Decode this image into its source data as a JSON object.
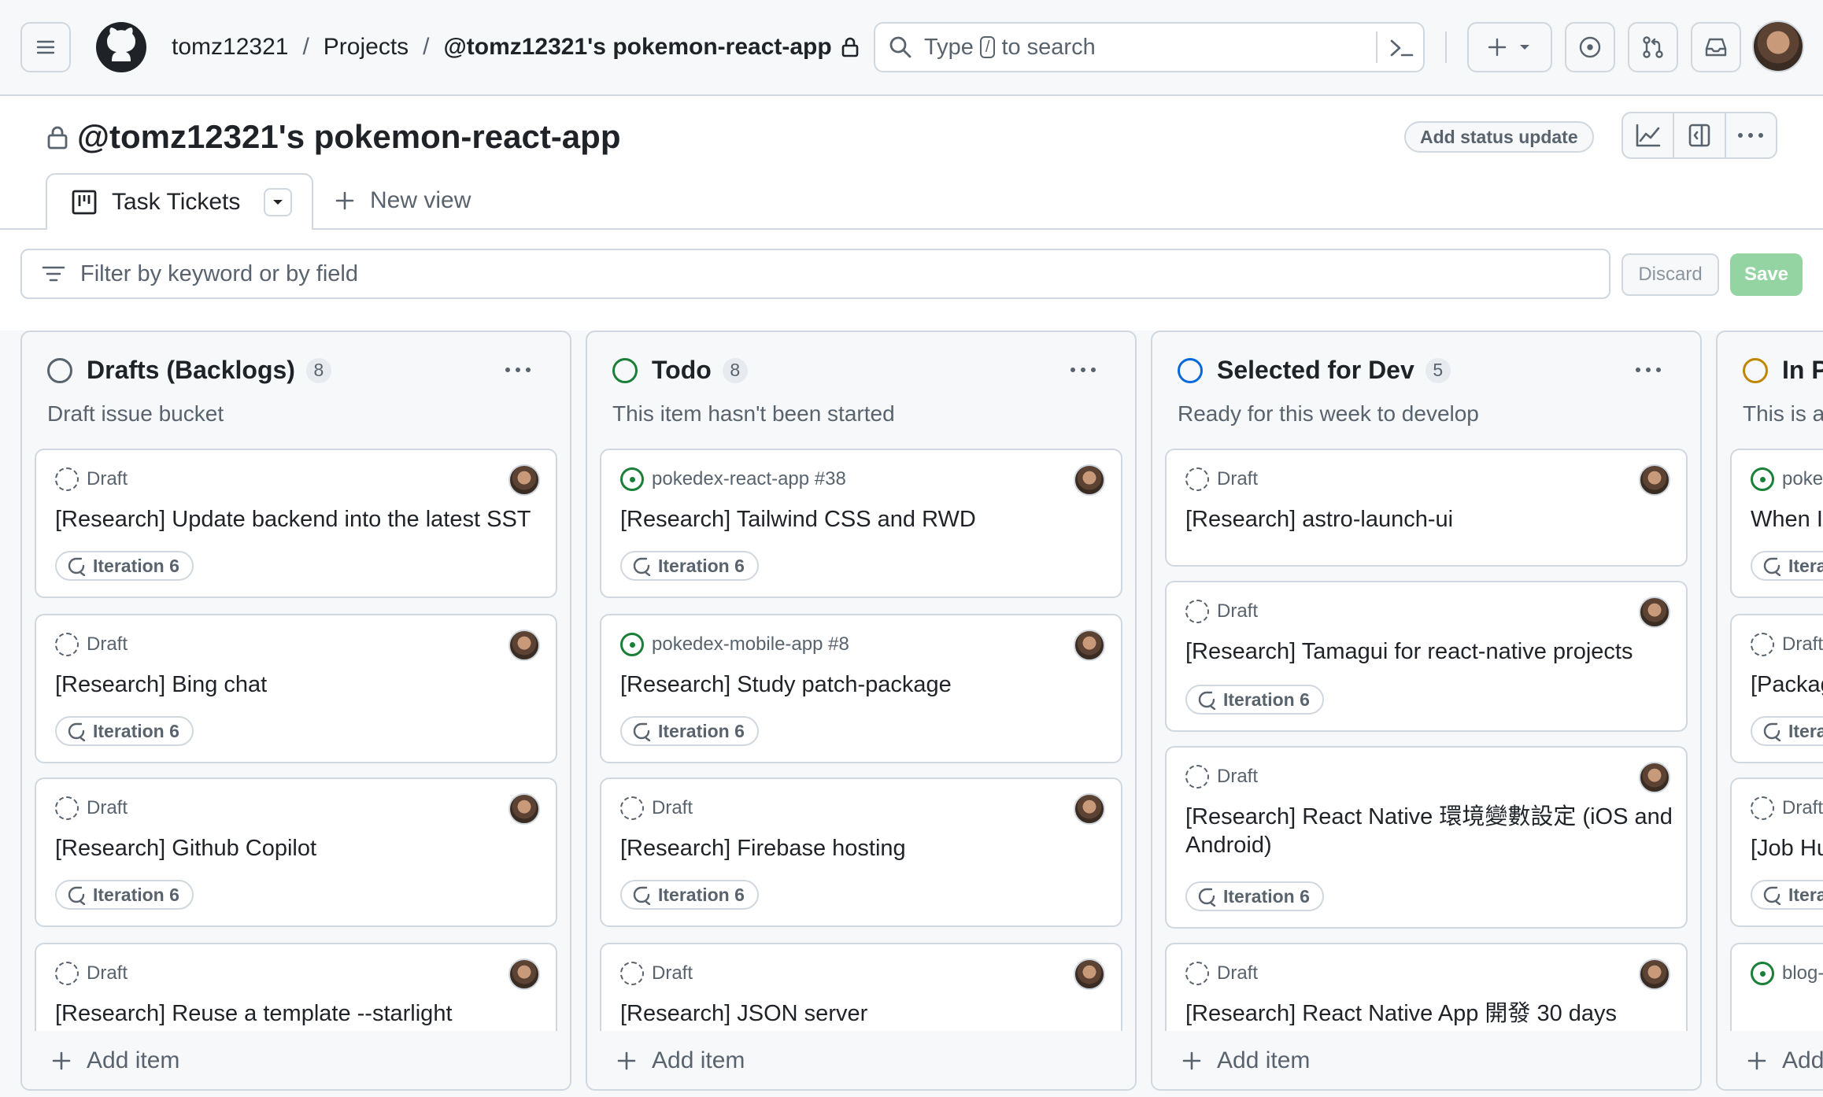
{
  "header": {
    "breadcrumb": {
      "owner": "tomz12321",
      "section": "Projects",
      "project": "@tomz12321's pokemon-react-app"
    },
    "search": {
      "prefix": "Type",
      "key": "/",
      "suffix": "to search"
    }
  },
  "project": {
    "title": "@tomz12321's pokemon-react-app",
    "status_button": "Add status update",
    "tabs": {
      "active": "Task Tickets",
      "new_view": "New view"
    }
  },
  "filter": {
    "placeholder": "Filter by keyword or by field",
    "discard": "Discard",
    "save": "Save"
  },
  "columns": [
    {
      "title": "Drafts (Backlogs)",
      "count": "8",
      "description": "Draft issue bucket",
      "status_color": "#59636e",
      "add_item": "Add item",
      "cards": [
        {
          "kind": "Draft",
          "title": "[Research] Update backend into the latest SST",
          "iteration": "Iteration 6"
        },
        {
          "kind": "Draft",
          "title": "[Research] Bing chat",
          "iteration": "Iteration 6"
        },
        {
          "kind": "Draft",
          "title": "[Research] Github Copilot",
          "iteration": "Iteration 6"
        },
        {
          "kind": "Draft",
          "title": "[Research] Reuse a template --starlight",
          "iteration": ""
        }
      ]
    },
    {
      "title": "Todo",
      "count": "8",
      "description": "This item hasn't been started",
      "status_color": "#1a7f37",
      "add_item": "Add item",
      "cards": [
        {
          "kind": "pokedex-react-app #38",
          "title": "[Research] Tailwind CSS and RWD",
          "iteration": "Iteration 6"
        },
        {
          "kind": "pokedex-mobile-app #8",
          "title": "[Research] Study patch-package",
          "iteration": "Iteration 6"
        },
        {
          "kind": "Draft",
          "title": "[Research] Firebase hosting",
          "iteration": "Iteration 6"
        },
        {
          "kind": "Draft",
          "title": "[Research] JSON server",
          "iteration": ""
        }
      ]
    },
    {
      "title": "Selected for Dev",
      "count": "5",
      "description": "Ready for this week to develop",
      "status_color": "#0969da",
      "add_item": "Add item",
      "cards": [
        {
          "kind": "Draft",
          "title": "[Research] astro-launch-ui",
          "iteration": ""
        },
        {
          "kind": "Draft",
          "title": "[Research] Tamagui for react-native projects",
          "iteration": "Iteration 6"
        },
        {
          "kind": "Draft",
          "title": "[Research] React Native 環境變數設定 (iOS and Android)",
          "iteration": "Iteration 6"
        },
        {
          "kind": "Draft",
          "title": "[Research] React Native App 開發 30 days",
          "iteration": ""
        }
      ]
    },
    {
      "title": "In Pr",
      "count": "",
      "description": "This is a",
      "status_color": "#bf8700",
      "add_item": "Add",
      "cards": [
        {
          "kind": "poke",
          "title": "When It and And",
          "iteration": "Itera"
        },
        {
          "kind": "Draft",
          "title": "[Packag",
          "iteration": "Itera"
        },
        {
          "kind": "Draft",
          "title": "[Job Hu",
          "iteration": "Itera"
        },
        {
          "kind": "blog-",
          "title": "",
          "iteration": ""
        }
      ]
    }
  ]
}
